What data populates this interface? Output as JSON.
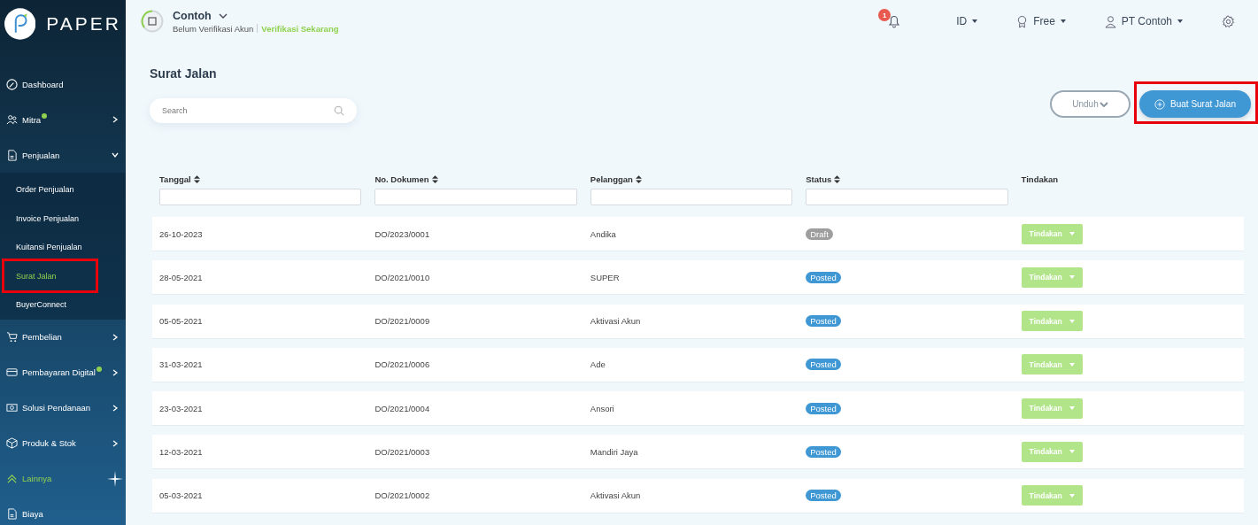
{
  "brand": {
    "name": "PAPER"
  },
  "sidebar": {
    "items": [
      {
        "label": "Dashboard",
        "kind": "link",
        "dot": false,
        "accent": false
      },
      {
        "label": "Mitra",
        "kind": "group",
        "expanded": false,
        "dot": true,
        "accent": false
      },
      {
        "label": "Penjualan",
        "kind": "group",
        "expanded": true,
        "dot": false,
        "accent": false,
        "children": [
          {
            "label": "Order Penjualan",
            "selected": false,
            "highlighted": false
          },
          {
            "label": "Invoice Penjualan",
            "selected": false,
            "highlighted": false
          },
          {
            "label": "Kuitansi Penjualan",
            "selected": false,
            "highlighted": false
          },
          {
            "label": "Surat Jalan",
            "selected": true,
            "highlighted": true
          },
          {
            "label": "BuyerConnect",
            "selected": false,
            "highlighted": false
          }
        ]
      },
      {
        "label": "Pembelian",
        "kind": "group",
        "expanded": false,
        "dot": false,
        "accent": false
      },
      {
        "label": "Pembayaran Digital",
        "kind": "group",
        "expanded": false,
        "dot": true,
        "accent": false
      },
      {
        "label": "Solusi Pendanaan",
        "kind": "group",
        "expanded": false,
        "dot": false,
        "accent": false
      },
      {
        "label": "Produk & Stok",
        "kind": "group",
        "expanded": false,
        "dot": false,
        "accent": false
      },
      {
        "label": "Lainnya",
        "kind": "link",
        "dot": false,
        "accent": true
      },
      {
        "label": "Biaya",
        "kind": "link",
        "dot": false,
        "accent": false
      }
    ]
  },
  "topbar": {
    "company": "Contoh",
    "verification_status": "Belum Verifikasi Akun",
    "verify_link": "Verifikasi Sekarang",
    "notification_count": "1",
    "language": "ID",
    "plan": "Free",
    "user": "PT Contoh"
  },
  "page": {
    "title": "Surat Jalan",
    "search": {
      "placeholder": "Search"
    },
    "download_button": "Unduh",
    "create_button": {
      "label": "Buat Surat Jalan",
      "highlighted": true
    }
  },
  "table": {
    "columns": [
      {
        "label": "Tanggal",
        "sortable": true
      },
      {
        "label": "No. Dokumen",
        "sortable": true
      },
      {
        "label": "Pelanggan",
        "sortable": true
      },
      {
        "label": "Status",
        "sortable": true
      },
      {
        "label": "Tindakan",
        "sortable": false
      }
    ],
    "rows": [
      {
        "date": "26-10-2023",
        "document": "DO/2023/0001",
        "customer": "Andika",
        "status": {
          "label": "Draft",
          "kind": "draft"
        },
        "action": "Tindakan"
      },
      {
        "date": "28-05-2021",
        "document": "DO/2021/0010",
        "customer": "SUPER",
        "status": {
          "label": "Posted",
          "kind": "posted"
        },
        "action": "Tindakan"
      },
      {
        "date": "05-05-2021",
        "document": "DO/2021/0009",
        "customer": "Aktivasi Akun",
        "status": {
          "label": "Posted",
          "kind": "posted"
        },
        "action": "Tindakan"
      },
      {
        "date": "31-03-2021",
        "document": "DO/2021/0006",
        "customer": "Ade",
        "status": {
          "label": "Posted",
          "kind": "posted"
        },
        "action": "Tindakan"
      },
      {
        "date": "23-03-2021",
        "document": "DO/2021/0004",
        "customer": "Ansori",
        "status": {
          "label": "Posted",
          "kind": "posted"
        },
        "action": "Tindakan"
      },
      {
        "date": "12-03-2021",
        "document": "DO/2021/0003",
        "customer": "Mandiri Jaya",
        "status": {
          "label": "Posted",
          "kind": "posted"
        },
        "action": "Tindakan"
      },
      {
        "date": "05-03-2021",
        "document": "DO/2021/0002",
        "customer": "Aktivasi Akun",
        "status": {
          "label": "Posted",
          "kind": "posted"
        },
        "action": "Tindakan"
      }
    ]
  }
}
